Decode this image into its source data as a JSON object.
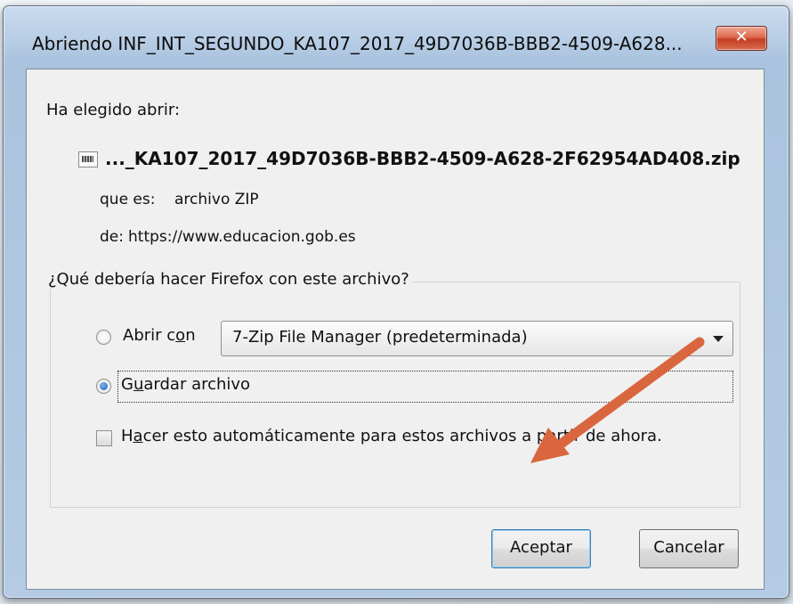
{
  "window": {
    "title": "Abriendo INF_INT_SEGUNDO_KA107_2017_49D7036B-BBB2-4509-A628...",
    "close_glyph": "✕"
  },
  "dialog": {
    "intro": "Ha elegido abrir:",
    "file_icon": "zip-file-icon",
    "filename": "..._KA107_2017_49D7036B-BBB2-4509-A628-2F62954AD408.zip",
    "type_label": "que es:",
    "type_value": "archivo ZIP",
    "from_label": "de:",
    "from_value": "https://www.educacion.gob.es",
    "group_label": "¿Qué debería hacer Firefox con este archivo?",
    "open_with": {
      "pre": "Abrir c",
      "accel": "o",
      "post": "n",
      "selected": false
    },
    "app_combo": "7-Zip File Manager (predeterminada)",
    "save_file": {
      "pre": "G",
      "accel": "u",
      "post": "ardar archivo",
      "selected": true
    },
    "auto": {
      "pre": "H",
      "accel": "a",
      "post": "cer esto automáticamente para estos archivos a partir de ahora.",
      "checked": false
    },
    "accept": "Aceptar",
    "cancel": "Cancelar"
  },
  "annotation": {
    "type": "arrow",
    "color": "#d9663e"
  }
}
